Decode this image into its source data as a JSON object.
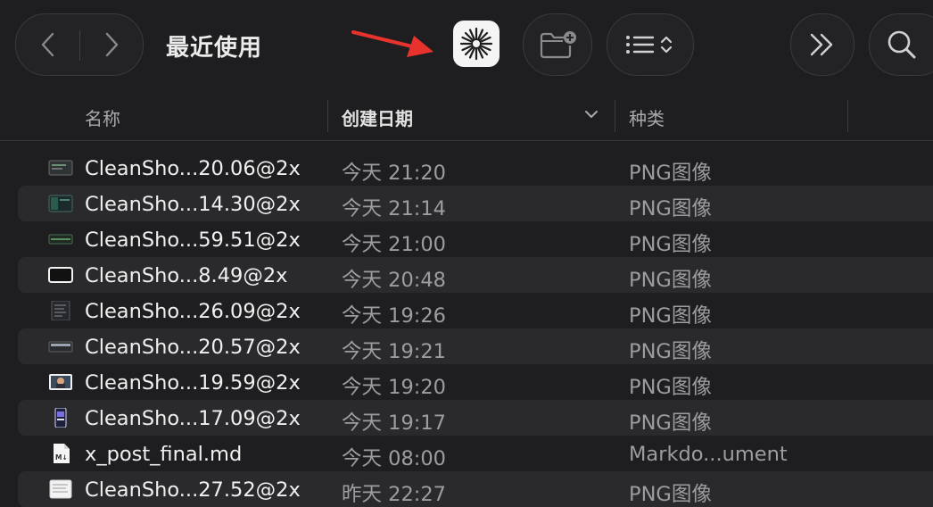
{
  "toolbar": {
    "title": "最近使用",
    "back_icon": "chevron-left-icon",
    "forward_icon": "chevron-right-icon",
    "app_icon": "sparkle-burst-icon",
    "new_folder_icon": "folder-plus-icon",
    "view_icon": "list-view-icon",
    "more_icon": "double-chevron-right-icon",
    "search_icon": "search-icon",
    "arrow_color": "#e8322e"
  },
  "columns": {
    "name": "名称",
    "date": "创建日期",
    "kind": "种类"
  },
  "files": [
    {
      "name": "CleanSho...20.06@2x",
      "date": "今天 21:20",
      "kind": "PNG图像",
      "thumb": "dark-terminal"
    },
    {
      "name": "CleanSho...14.30@2x",
      "date": "今天 21:14",
      "kind": "PNG图像",
      "thumb": "dark-green"
    },
    {
      "name": "CleanSho...59.51@2x",
      "date": "今天 21:00",
      "kind": "PNG图像",
      "thumb": "dark-bar"
    },
    {
      "name": "CleanSho...8.49@2x",
      "date": "今天 20:48",
      "kind": "PNG图像",
      "thumb": "white-window"
    },
    {
      "name": "CleanSho...26.09@2x",
      "date": "今天 19:26",
      "kind": "PNG图像",
      "thumb": "dark-list"
    },
    {
      "name": "CleanSho...20.57@2x",
      "date": "今天 19:21",
      "kind": "PNG图像",
      "thumb": "dark-wide"
    },
    {
      "name": "CleanSho...19.59@2x",
      "date": "今天 19:20",
      "kind": "PNG图像",
      "thumb": "photo"
    },
    {
      "name": "CleanSho...17.09@2x",
      "date": "今天 19:17",
      "kind": "PNG图像",
      "thumb": "phone"
    },
    {
      "name": "x_post_final.md",
      "date": "今天 08:00",
      "kind": "Markdo...ument",
      "thumb": "markdown-doc"
    },
    {
      "name": "CleanSho...27.52@2x",
      "date": "昨天 22:27",
      "kind": "PNG图像",
      "thumb": "light-doc"
    }
  ]
}
